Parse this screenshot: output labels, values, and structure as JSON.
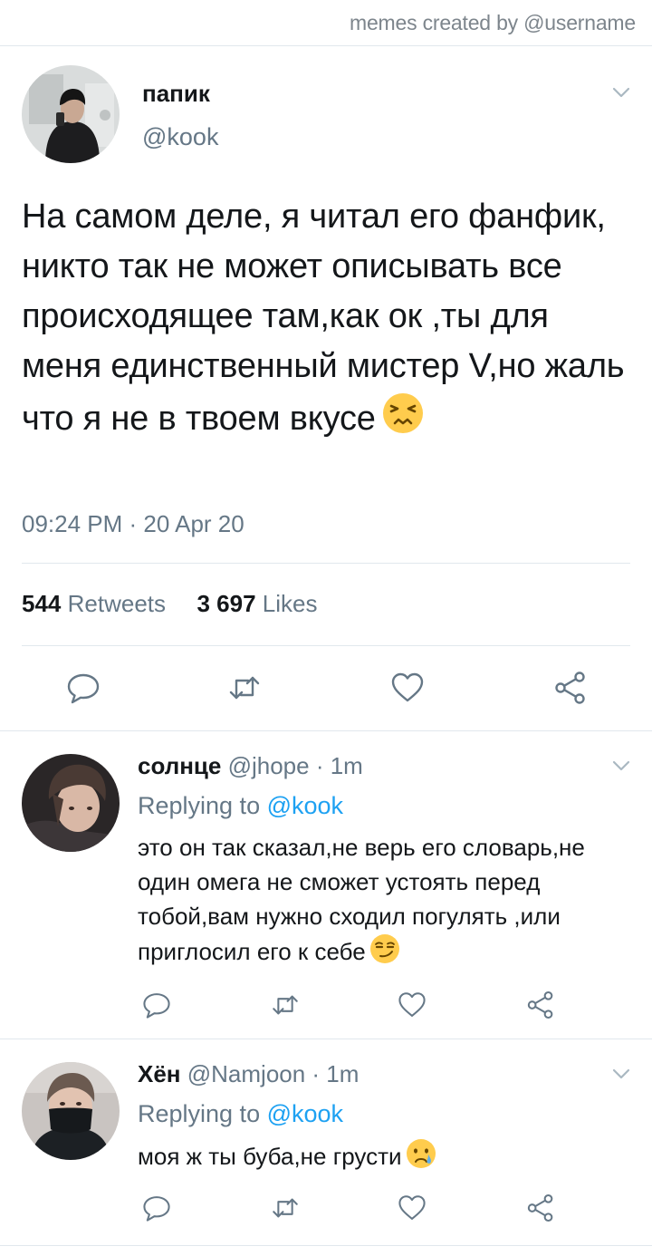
{
  "watermark": "memes created by @username",
  "tweet": {
    "name": "папик",
    "handle": "@kook",
    "text": "На самом деле, я читал его фанфик, никто так не может описывать все происходящее там,как ок ,ты для меня единственный мистер V,но жаль что я не в твоем вкусе",
    "emoji": "persevering-face-emoji",
    "timestamp": "09:24 PM · 20 Apr 20",
    "retweets_count": "544",
    "retweets_label": "Retweets",
    "likes_count": "3 697",
    "likes_label": "Likes"
  },
  "replies": [
    {
      "name": "солнце",
      "handle_time": "@jhope · 1m",
      "replying_prefix": "Replying to",
      "replying_to": "@kook",
      "text": "это он так сказал,не верь его словарь,не один омега не сможет устоять перед тобой,вам нужно сходил погулять ,или приглосил его к себе",
      "emoji": "smirking-face-emoji"
    },
    {
      "name": "Хён",
      "handle_time": "@Namjoon · 1m",
      "replying_prefix": "Replying to",
      "replying_to": "@kook",
      "text": "моя ж ты буба,не грусти",
      "emoji": "crying-face-emoji"
    }
  ],
  "colors": {
    "text": "#14171a",
    "secondary": "#657786",
    "link": "#1da1f2",
    "divider": "#e1e8ed"
  },
  "icons": [
    "reply-icon",
    "retweet-icon",
    "like-icon",
    "share-icon",
    "chevron-down-icon"
  ]
}
